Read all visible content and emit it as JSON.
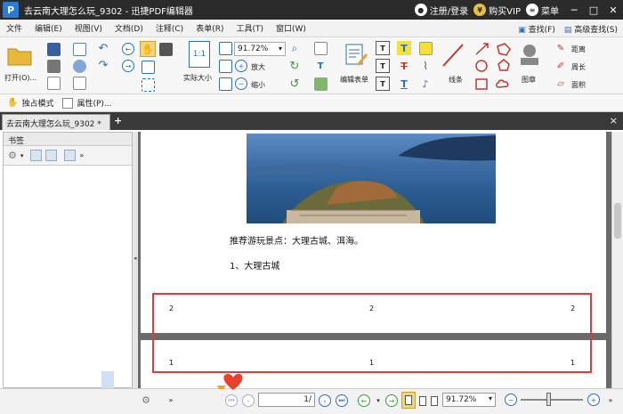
{
  "window": {
    "title": "去云南大理怎么玩_9302 - 迅捷PDF编辑器",
    "logo_letter": "P",
    "login_label": "注册/登录",
    "vip_label": "购买VIP",
    "menu_label": "菜单",
    "vip_symbol": "¥"
  },
  "menu": {
    "items": [
      "文件",
      "编辑(E)",
      "视图(V)",
      "文档(D)",
      "注释(C)",
      "表单(R)",
      "工具(T)",
      "窗口(W)"
    ],
    "find_label": "查找(F)",
    "advanced_find_label": "高级查找(S)"
  },
  "toolbar": {
    "open_label": "打开(O)...",
    "actual_size_label": "实际大小",
    "zoom_value": "91.72%",
    "zoom_in_label": "放大",
    "zoom_out_label": "缩小",
    "edit_form_label": "编辑表单",
    "line_label": "线条",
    "stamp_label": "图章",
    "distance_label": "距离",
    "perimeter_label": "周长",
    "area_label": "面积",
    "actual_size_glyph": "1:1"
  },
  "mode_strip": {
    "exclusive_mode": "独占模式",
    "properties": "属性(P)..."
  },
  "tabs": {
    "active": "去云南大理怎么玩_9302 *",
    "add": "+",
    "close": "×"
  },
  "panel": {
    "title": "书签"
  },
  "document": {
    "recommend_text": "推荐游玩景点：大理古城、洱海。",
    "section_title": "1、大理古城",
    "page2_numbers": [
      "2",
      "2",
      "2"
    ],
    "page1_numbers": [
      "1",
      "1",
      "1"
    ]
  },
  "statusbar": {
    "page_indicator": "1/",
    "zoom_value": "91.72%"
  },
  "colors": {
    "highlight": "#e23a3a",
    "titlebar": "#2b2b2b",
    "accent": "#2a7bd6"
  }
}
